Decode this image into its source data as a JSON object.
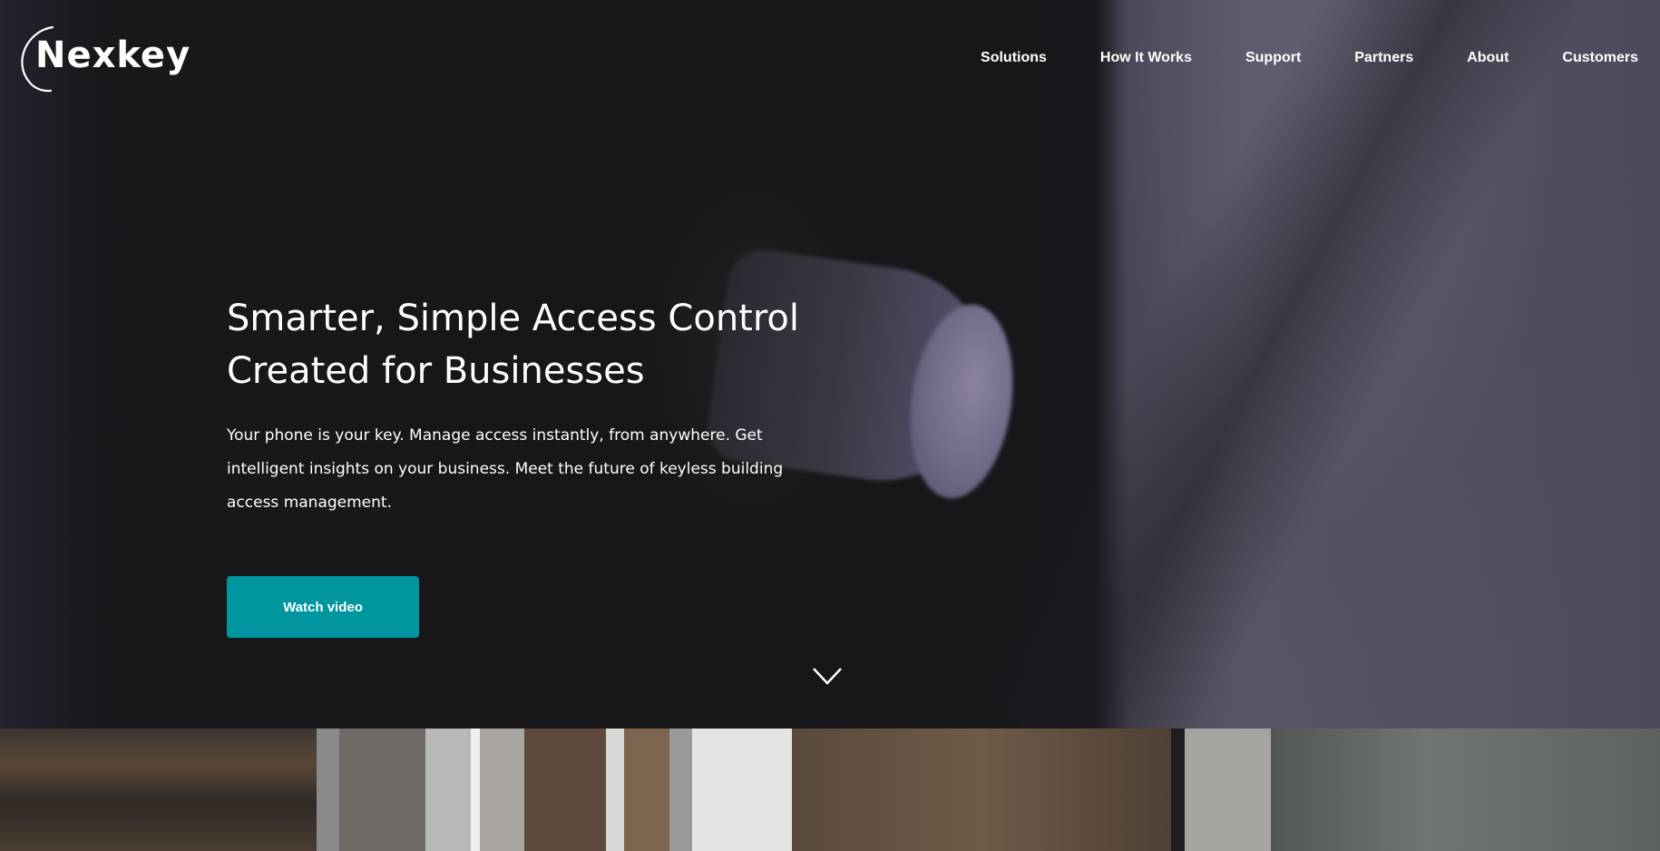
{
  "brand": {
    "name": "Nexkey"
  },
  "nav": {
    "items": [
      {
        "label": "Solutions",
        "name": "nav-solutions"
      },
      {
        "label": "How It Works",
        "name": "nav-how-it-works"
      },
      {
        "label": "Support",
        "name": "nav-support"
      },
      {
        "label": "Partners",
        "name": "nav-partners"
      },
      {
        "label": "About",
        "name": "nav-about"
      },
      {
        "label": "Customers",
        "name": "nav-customers"
      }
    ]
  },
  "hero": {
    "headline_line1": "Smarter, Simple Access Control",
    "headline_line2": "Created for Businesses",
    "description": "Your phone is your key. Manage access instantly, from anywhere. Get intelligent insights on your business. Meet the future of keyless building access management.",
    "cta_label": "Watch video",
    "scroll_icon": "chevron-down-icon"
  },
  "colors": {
    "accent": "#00969f",
    "hero_dark": "#17171a",
    "hero_purple": "#5b5667"
  }
}
